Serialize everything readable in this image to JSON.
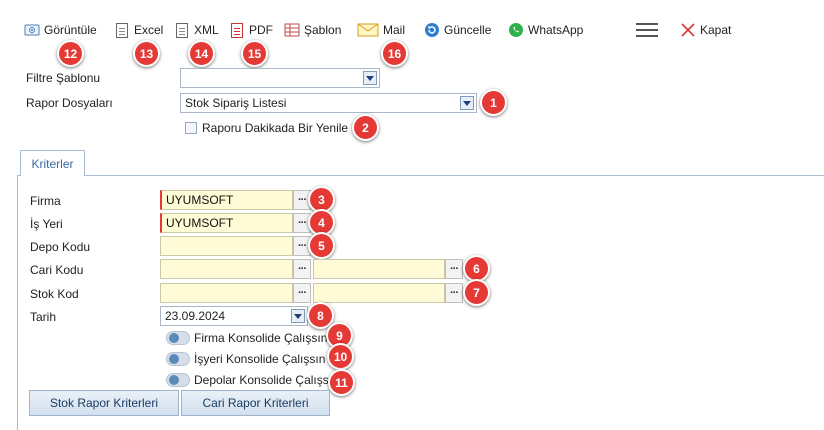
{
  "toolbar": {
    "view": "Görüntüle",
    "excel": "Excel",
    "xml": "XML",
    "pdf": "PDF",
    "template": "Şablon",
    "mail": "Mail",
    "refresh": "Güncelle",
    "whatsapp": "WhatsApp",
    "close": "Kapat"
  },
  "form": {
    "filter_template_label": "Filtre Şablonu",
    "filter_template_value": "",
    "report_files_label": "Rapor Dosyaları",
    "report_files_value": "Stok Sipariş Listesi",
    "refresh_minute_label": "Raporu Dakikada Bir Yenile"
  },
  "tab": {
    "criteria": "Kriterler"
  },
  "criteria": {
    "firma_label": "Firma",
    "firma_value": "UYUMSOFT",
    "isyeri_label": "İş Yeri",
    "isyeri_value": "UYUMSOFT",
    "depo_label": "Depo Kodu",
    "depo_value": "",
    "cari_label": "Cari Kodu",
    "cari_value_from": "",
    "cari_value_to": "",
    "stok_label": "Stok Kod",
    "stok_value_from": "",
    "stok_value_to": "",
    "tarih_label": "Tarih",
    "tarih_value": "23.09.2024",
    "firma_consolidate": "Firma Konsolide Çalışsın",
    "isyeri_consolidate": "İşyeri Konsolide Çalışsın",
    "depo_consolidate": "Depolar Konsolide Çalışsın"
  },
  "buttons": {
    "stock_criteria": "Stok Rapor Kriterleri",
    "account_criteria": "Cari Rapor Kriterleri"
  },
  "badges": [
    "1",
    "2",
    "3",
    "4",
    "5",
    "6",
    "7",
    "8",
    "9",
    "10",
    "11",
    "12",
    "13",
    "14",
    "15",
    "16"
  ],
  "colors": {
    "badge": "#e53935",
    "input_bg": "#fffbd6",
    "required_marker": "#e53935",
    "tab_text": "#3a6aa0"
  }
}
